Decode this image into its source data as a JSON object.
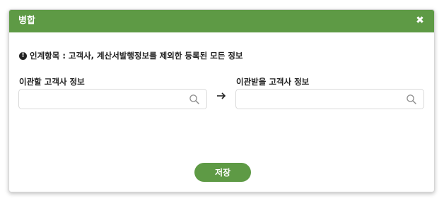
{
  "dialog": {
    "title": "병합",
    "close_icon": "close-icon",
    "info_text": "인계항목 : 고객사, 계산서발행정보를 제외한 등록된 모든 정보",
    "info_icon": "info-circle-icon",
    "source": {
      "label": "이관할 고객사 정보",
      "value": "",
      "placeholder": ""
    },
    "target": {
      "label": "이관받을 고객사 정보",
      "value": "",
      "placeholder": ""
    },
    "save_label": "저장"
  },
  "colors": {
    "accent": "#5e9a45",
    "text": "#222222",
    "border": "#d9d9d9"
  }
}
